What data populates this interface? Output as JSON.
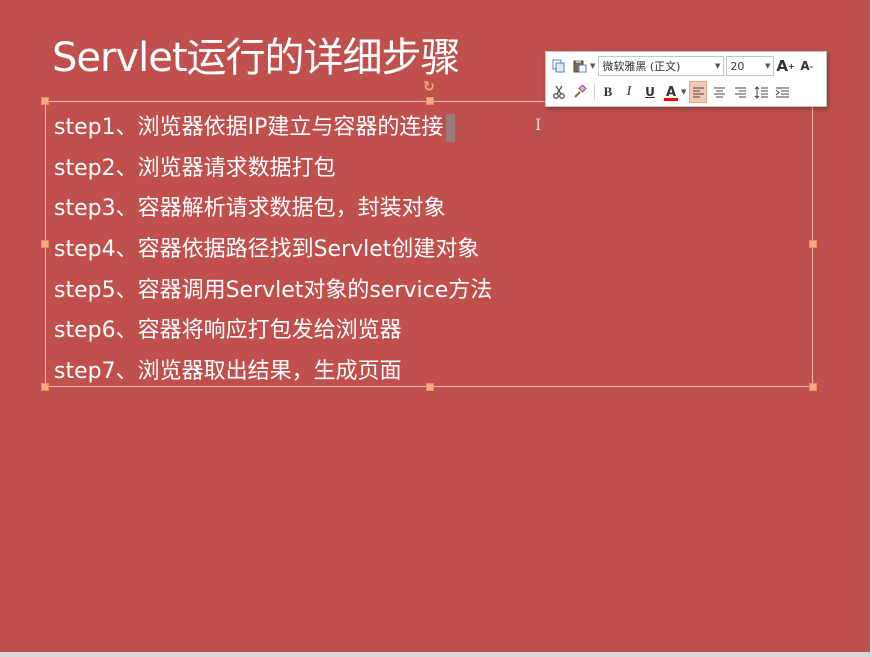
{
  "slide": {
    "title": "Servlet运行的详细步骤",
    "background_color": "#c0504d",
    "steps": [
      "step1、浏览器依据IP建立与容器的连接",
      "step2、浏览器请求数据打包",
      "step3、容器解析请求数据包，封装对象",
      "step4、容器依据路径找到Servlet创建对象",
      "step5、容器调用Servlet对象的service方法",
      "step6、容器将响应打包发给浏览器",
      "step7、浏览器取出结果，生成页面"
    ]
  },
  "toolbar": {
    "font_name": "微软雅黑 (正文)",
    "font_size": "20",
    "icons": {
      "copy": "copy-icon",
      "paste": "paste-icon",
      "grow_font": "A",
      "shrink_font": "A",
      "cut": "scissors-icon",
      "format_painter": "brush-icon",
      "bold": "B",
      "italic": "I",
      "underline": "U",
      "font_color": "A",
      "align_left": "align-left-icon",
      "align_center": "align-center-icon",
      "align_right": "align-right-icon",
      "line_spacing": "line-spacing-icon",
      "indent": "indent-icon"
    },
    "font_color_bar": "#ff0000",
    "active_alignment": "left"
  }
}
